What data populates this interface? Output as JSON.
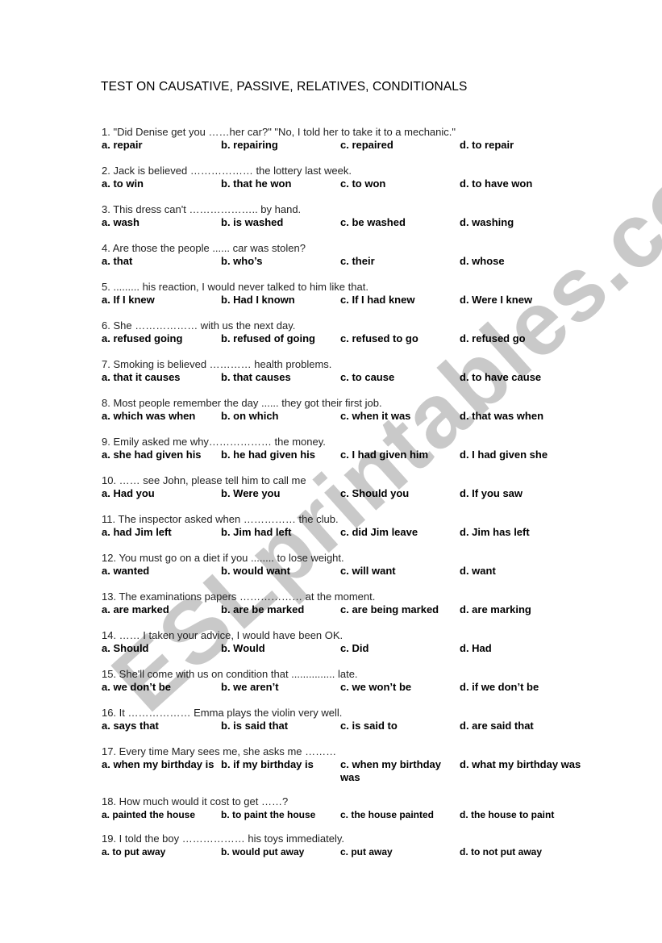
{
  "title": "TEST ON CAUSATIVE, PASSIVE, RELATIVES, CONDITIONALS",
  "watermark": "ESLprintables.com",
  "questions": [
    {
      "stem": "1.   \"Did Denise get you ……her car?\"  \"No, I told her to take it to a mechanic.\"",
      "options": [
        "a. repair",
        "b. repairing",
        "c. repaired",
        "d. to repair"
      ]
    },
    {
      "stem": "2.   Jack is believed ……………… the lottery last week.",
      "options": [
        "a. to win",
        "b. that he won",
        "c. to won",
        "d. to have won"
      ]
    },
    {
      "stem": "3.   This dress can't ……………….. by hand.",
      "options": [
        "a. wash",
        "b. is washed",
        "c. be washed",
        "d. washing"
      ]
    },
    {
      "stem": "4.    Are those the people ...... car was stolen?",
      "options": [
        "a. that",
        "b. who’s",
        "c. their",
        "d. whose"
      ]
    },
    {
      "stem": "5.    ......... his reaction, I would never talked to him like that.",
      "options": [
        "a. If I knew",
        "b. Had I known",
        "c. If I had knew",
        "d. Were I knew"
      ]
    },
    {
      "stem": "6.   She ……………… with us the next day.",
      "options": [
        "a. refused going",
        "b. refused of going",
        "c. refused to go",
        "d. refused go"
      ]
    },
    {
      "stem": "7.   Smoking is believed ………… health problems.",
      "options": [
        "a. that it causes",
        "b. that causes",
        "c. to cause",
        "d. to have cause"
      ]
    },
    {
      "stem": "8.   Most people remember the day ...... they got their first job.",
      "options": [
        "a. which was when",
        "b. on which",
        "c. when it was",
        "d. that was when"
      ]
    },
    {
      "stem": "9.   Emily asked me why……………… the money.",
      "options": [
        "a. she had given his",
        "b. he had given his",
        "c. I had given him",
        "d. I had given she"
      ]
    },
    {
      "stem": "10. ……  see John, please tell him to call me",
      "options": [
        "a. Had you",
        "b. Were you",
        "c. Should you",
        "d. If you saw"
      ]
    },
    {
      "stem": "11. The inspector asked when …………… the club.",
      "options": [
        "a. had Jim left",
        "b. Jim had left",
        "c. did Jim leave",
        "d. Jim has left"
      ]
    },
    {
      "stem": "12. You must go on a diet if you ........ to lose weight.",
      "options": [
        "a. wanted",
        "b. would want",
        "c. will want",
        "d. want"
      ]
    },
    {
      "stem": "13.  The examinations papers ……………… at the moment.",
      "options": [
        "a. are marked",
        "b. are be marked",
        "c. are being marked",
        "d. are marking"
      ]
    },
    {
      "stem": "14. …… I taken your advice, I would have been OK.",
      "options": [
        "a. Should",
        "b. Would",
        "c. Did",
        "d. Had"
      ]
    },
    {
      "stem": "15. She'll come with us on condition that ............... late.",
      "options": [
        "a. we don’t be",
        "b. we aren’t",
        "c. we won’t be",
        "d. if we don’t be"
      ]
    },
    {
      "stem": "16. It ……………… Emma plays the violin very well.",
      "options": [
        "a. says that",
        "b. is said that",
        "c. is said to",
        "d. are said that"
      ]
    },
    {
      "stem": "17. Every time Mary sees me, she asks me ………",
      "options": [
        "a. when my birthday is",
        "b. if my birthday is",
        "c. when my birthday was",
        "d. what my birthday was"
      ]
    },
    {
      "stem": "18. How much would it cost to get ……?",
      "options": [
        "a. painted the house",
        "b. to paint the house",
        "c. the house painted",
        "d. the house to paint"
      ]
    },
    {
      "stem": "19. I told the boy ……………… his toys immediately.",
      "options": [
        "a. to put away",
        "b. would put away",
        "c. put away",
        "d. to not put away"
      ]
    }
  ]
}
